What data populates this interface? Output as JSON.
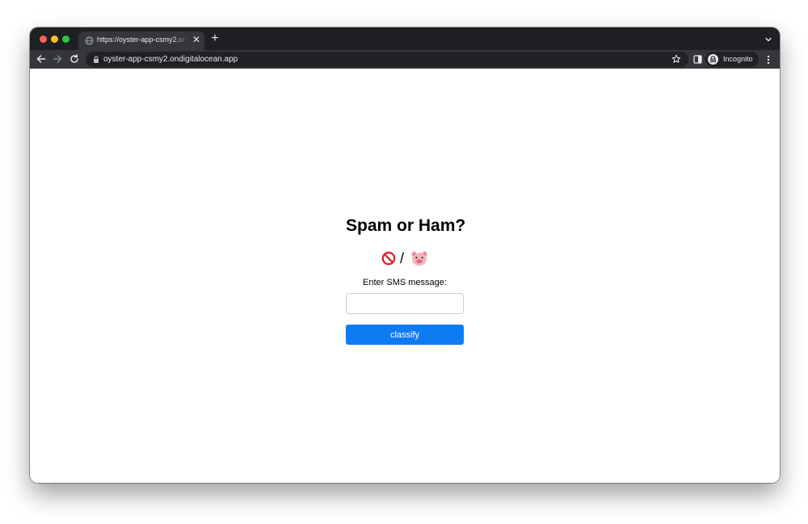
{
  "browser": {
    "tab": {
      "title": "https://oyster-app-csmy2.ondigitalocean.app",
      "favicon": "globe-icon",
      "close_glyph": "✕"
    },
    "new_tab_glyph": "+",
    "address_bar": {
      "url": "oyster-app-csmy2.ondigitalocean.app"
    },
    "profile": {
      "label": "Incognito"
    },
    "colors": {
      "frame": "#1f2023",
      "toolbar": "#35363a",
      "omnibox": "#202124",
      "text": "#e8eaed",
      "close": "#ff5f57",
      "minimize": "#febc2e",
      "maximize": "#28c840"
    }
  },
  "page": {
    "title": "Spam or Ham?",
    "emoji": {
      "left": "no-entry-sign-icon",
      "separator": "/",
      "right": "pig-face-icon"
    },
    "input_label": "Enter SMS message:",
    "input_value": "",
    "input_placeholder": "",
    "button_label": "classify",
    "colors": {
      "button": "#0d7cf2",
      "button_text": "#ffffff",
      "input_border": "#cfcfcf"
    }
  }
}
